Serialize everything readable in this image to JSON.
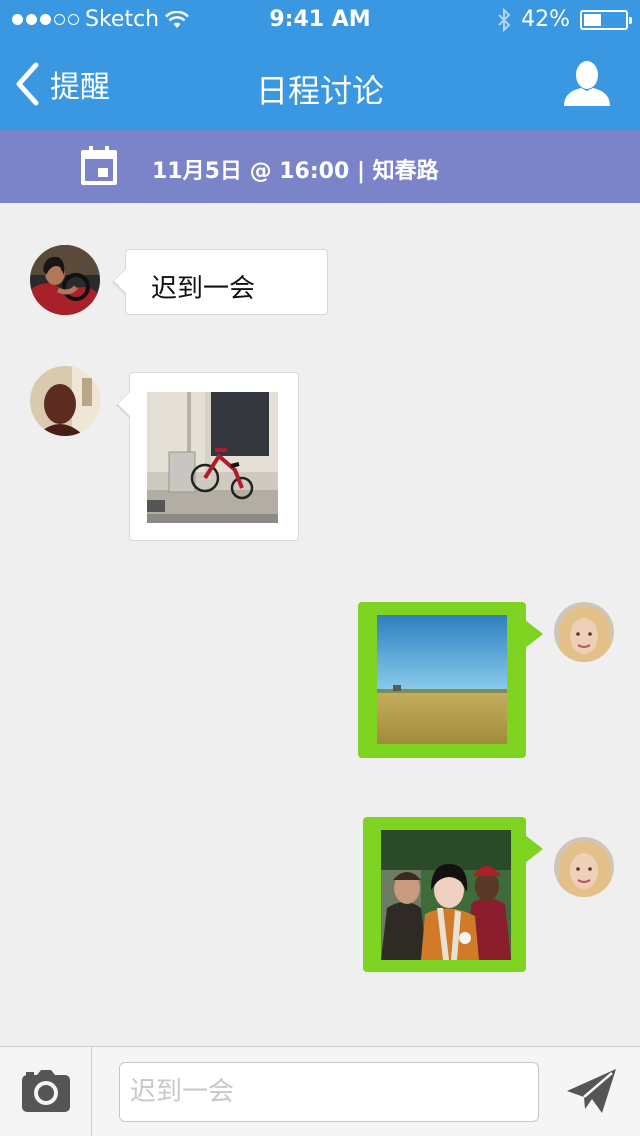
{
  "status_bar": {
    "carrier": "Sketch",
    "time": "9:41 AM",
    "battery_percent": "42%",
    "battery_level": 0.42
  },
  "nav": {
    "back_label": "提醒",
    "title": "日程讨论"
  },
  "event": {
    "summary_prefix": "11月5日 @ ",
    "summary_time": "16:00",
    "summary_suffix": " | 知春路"
  },
  "messages": [
    {
      "direction": "incoming",
      "type": "text",
      "text": "迟到一会"
    },
    {
      "direction": "incoming",
      "type": "image",
      "subject": "red tricycle on sidewalk"
    },
    {
      "direction": "outgoing",
      "type": "image",
      "subject": "wheat field under blue sky"
    },
    {
      "direction": "outgoing",
      "type": "image",
      "subject": "three people group portrait"
    }
  ],
  "composer": {
    "placeholder": "迟到一会"
  },
  "colors": {
    "nav_blue": "#3a97e1",
    "event_purple": "#7b83c9",
    "outgoing_green": "#7ed321",
    "chat_background": "#efefef"
  },
  "icons": {
    "back": "chevron-left-icon",
    "profile": "user-icon",
    "calendar": "calendar-icon",
    "camera": "camera-icon",
    "send": "paper-plane-icon",
    "wifi": "wifi-icon",
    "bluetooth": "bluetooth-icon",
    "battery": "battery-icon"
  }
}
